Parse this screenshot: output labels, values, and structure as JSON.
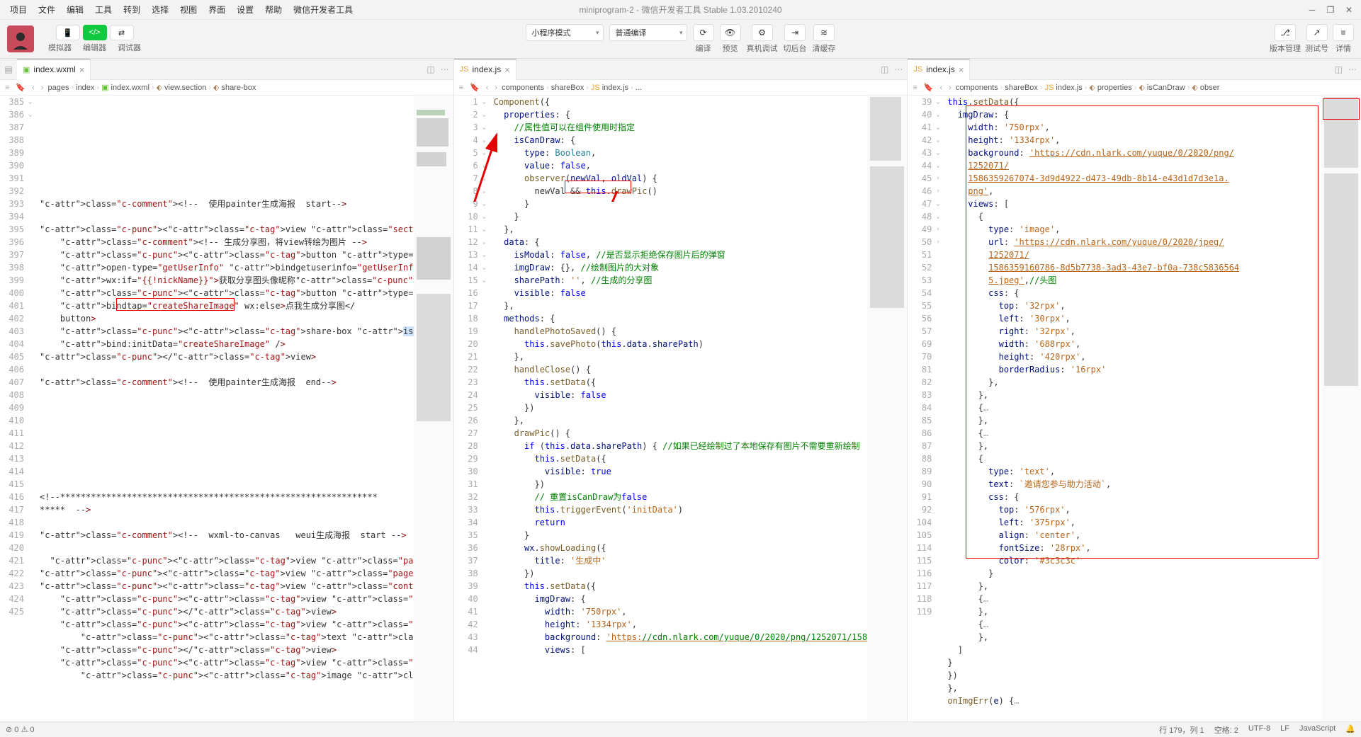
{
  "menubar": {
    "items": [
      "项目",
      "文件",
      "编辑",
      "工具",
      "转到",
      "选择",
      "视图",
      "界面",
      "设置",
      "帮助",
      "微信开发者工具"
    ],
    "title": "miniprogram-2 - 微信开发者工具 Stable 1.03.2010240"
  },
  "toolbar": {
    "mode_labels": [
      "模拟器",
      "编辑器",
      "调试器"
    ],
    "dropdowns": {
      "mode": "小程序模式",
      "compile": "普通编译"
    },
    "center_actions": [
      "编译",
      "预览",
      "真机调试",
      "切后台",
      "清缓存"
    ],
    "right_labels": [
      "版本管理",
      "测试号",
      "详情"
    ]
  },
  "pane1": {
    "tab": "index.wxml",
    "breadcrumb": [
      "pages",
      "index",
      "index.wxml",
      "view.section",
      "share-box"
    ],
    "lines_start": 385,
    "lines": [
      "",
      "",
      "",
      "",
      "",
      "",
      "",
      "",
      "<!--  使用painter生成海报  start-->",
      "",
      "<view class=\"section\">",
      "    <!-- 生成分享图，将view转绘为图片 -->",
      "    <button type=\"primary\" class=\"intro\"",
      "    open-type=\"getUserInfo\" bindgetuserinfo=\"getUserInfo\"",
      "    wx:if=\"{{!nickName}}\">获取分享图头像昵称</button>",
      "    <button type=\"primary\" class=\"intro\"",
      "    bindtap=\"createShareImage\" wx:else>点我生成分享图</",
      "    button>",
      "    <share-box isCanDraw=\"{{isCanDraw}}\"",
      "    bind:initData=\"createShareImage\" />",
      "</view>",
      "",
      "<!--  使用painter生成海报  end-->",
      "",
      "",
      "",
      "",
      "",
      "",
      "",
      "",
      "<!--**************************************************************",
      "*****  -->",
      "",
      "<!--  wxml-to-canvas   weui生成海报  start -->",
      "",
      "  <view class=\"page-section\">",
      "<view class=\"page-section-title\">wxml</view>",
      "<view class=\"container\">",
      "    <view class=\"item-box red\">",
      "    </view>",
      "    <view class=\"item-box green\">",
      "        <text class=\"text\">yeah!</text>",
      "    </view>",
      "    <view class=\"item-box blue\">",
      "        <image class=\"img\""
    ]
  },
  "pane2": {
    "tab": "index.js",
    "breadcrumb": [
      "components",
      "shareBox",
      "index.js",
      "..."
    ],
    "code": "Component({\n  properties: {\n    //属性值可以在组件使用时指定\n    isCanDraw: {\n      type: Boolean,\n      value: false,\n      observer(newVal, oldVal) {\n        newVal && this.drawPic()\n      }\n    }\n  },\n  data: {\n    isModal: false, //是否显示拒绝保存图片后的弹窗\n    imgDraw: {}, //绘制图片的大对象\n    sharePath: '', //生成的分享图\n    visible: false\n  },\n  methods: {\n    handlePhotoSaved() {\n      this.savePhoto(this.data.sharePath)\n    },\n    handleClose() {\n      this.setData({\n        visible: false\n      })\n    },\n    drawPic() {\n      if (this.data.sharePath) { //如果已经绘制过了本地保存有图片不需要重新绘制\n        this.setData({\n          visible: true\n        })\n        // 重置isCanDraw为false\n        this.triggerEvent('initData')\n        return\n      }\n      wx.showLoading({\n        title: '生成中'\n      })\n      this.setData({\n        imgDraw: {\n          width: '750rpx',\n          height: '1334rpx',\n          background: 'https://cdn.nlark.com/yuque/0/2020/png/1252071/1586359267074-3d9d4922-d473-49db-8b14-e43d1d7d3e1a.png',\n          views: ["
  },
  "pane3": {
    "tab": "index.js",
    "breadcrumb": [
      "components",
      "shareBox",
      "index.js",
      "properties",
      "isCanDraw",
      "obser"
    ],
    "line_numbers": [
      39,
      40,
      41,
      42,
      43,
      "",
      "",
      "",
      44,
      45,
      46,
      47,
      "",
      "",
      "",
      48,
      49,
      50,
      51,
      52,
      53,
      54,
      55,
      56,
      57,
      69,
      70,
      81,
      82,
      83,
      84,
      85,
      86,
      87,
      88,
      89,
      90,
      91,
      92,
      104,
      105,
      114,
      115,
      116,
      117,
      118,
      119
    ],
    "code_html": "<span class='c-kw'>this</span>.<span class='c-fn'>setData</span>({\n  <span class='c-prop'>imgDraw</span>: {\n    <span class='c-prop'>width</span>: <span class='c-str2'>'750rpx'</span>,\n    <span class='c-prop'>height</span>: <span class='c-str2'>'1334rpx'</span>,\n    <span class='c-prop'>background</span>: <span class='c-link'>'https://cdn.nlark.com/yuque/0/2020/png/</span>\n    <span class='c-link'>1252071/</span>\n    <span class='c-link'>1586359267074-3d9d4922-d473-49db-8b14-e43d1d7d3e1a.</span>\n    <span class='c-link'>png'</span>,\n    <span class='c-prop'>views</span>: [\n      {\n        <span class='c-prop'>type</span>: <span class='c-str2'>'image'</span>,\n        <span class='c-prop'>url</span>: <span class='c-link'>'https://cdn.nlark.com/yuque/0/2020/jpeg/</span>\n        <span class='c-link'>1252071/</span>\n        <span class='c-link'>1586359160786-8d5b7738-3ad3-43e7-bf0a-738c5836564</span>\n        <span class='c-link'>5.jpeg'</span>,<span class='c-comment'>//头图</span>\n        <span class='c-prop'>css</span>: {\n          <span class='c-prop'>top</span>: <span class='c-str2'>'32rpx'</span>,\n          <span class='c-prop'>left</span>: <span class='c-str2'>'30rpx'</span>,\n          <span class='c-prop'>right</span>: <span class='c-str2'>'32rpx'</span>,\n          <span class='c-prop'>width</span>: <span class='c-str2'>'688rpx'</span>,\n          <span class='c-prop'>height</span>: <span class='c-str2'>'420rpx'</span>,\n          <span class='c-prop'>borderRadius</span>: <span class='c-str2'>'16rpx'</span>\n        },\n      },\n      {<span style='color:#aaa'>…</span>\n      },\n      {<span style='color:#aaa'>…</span>\n      },\n      {\n        <span class='c-prop'>type</span>: <span class='c-str2'>'text'</span>,\n        <span class='c-prop'>text</span>: <span class='c-str2'>`邀请您参与助力活动`</span>,\n        <span class='c-prop'>css</span>: {\n          <span class='c-prop'>top</span>: <span class='c-str2'>'576rpx'</span>,\n          <span class='c-prop'>left</span>: <span class='c-str2'>'375rpx'</span>,\n          <span class='c-prop'>align</span>: <span class='c-str2'>'center'</span>,\n          <span class='c-prop'>fontSize</span>: <span class='c-str2'>'28rpx'</span>,\n          <span class='c-prop'>color</span>: <span class='c-str2'>'#3c3c3c'</span>\n        }\n      },\n      {<span style='color:#aaa'>…</span>\n      },\n      {<span style='color:#aaa'>…</span>\n      },\n  ]\n}\n})\n},\n<span class='c-fn'>onImgErr</span>(<span class='c-prop'>e</span>) {<span style='color:#aaa'>…</span>"
  },
  "statusbar": {
    "left_icons": "⊘ 0 ⚠ 0",
    "cursor": "行 179，列 1",
    "spaces": "空格: 2",
    "encoding": "UTF-8",
    "eol": "LF",
    "lang": "JavaScript",
    "bell": "🔔"
  }
}
